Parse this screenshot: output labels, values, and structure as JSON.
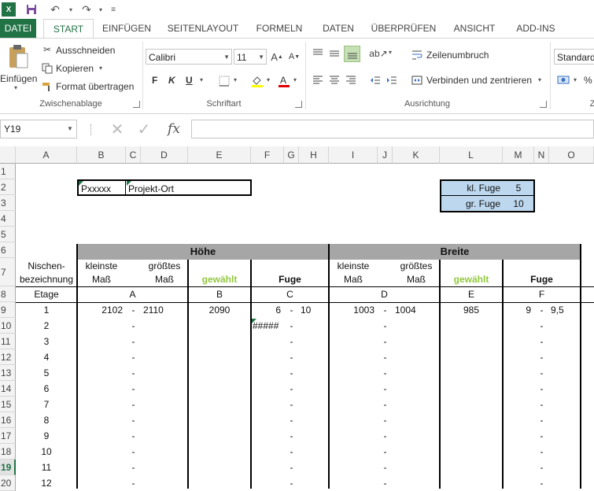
{
  "quick_access": {
    "app_icon": "excel-icon",
    "save_icon": "save-icon",
    "undo_icon": "undo-icon",
    "redo_icon": "redo-icon",
    "customize_icon": "customize-qat-icon"
  },
  "tabs": [
    {
      "label": "DATEI"
    },
    {
      "label": "START"
    },
    {
      "label": "EINFÜGEN"
    },
    {
      "label": "SEITENLAYOUT"
    },
    {
      "label": "FORMELN"
    },
    {
      "label": "DATEN"
    },
    {
      "label": "ÜBERPRÜFEN"
    },
    {
      "label": "ANSICHT"
    },
    {
      "label": "ADD-INS"
    }
  ],
  "ribbon": {
    "clipboard": {
      "paste_label": "Einfügen",
      "cut_label": "Ausschneiden",
      "copy_label": "Kopieren",
      "format_painter_label": "Format übertragen",
      "group_label": "Zwischenablage"
    },
    "font": {
      "font_name": "Calibri",
      "font_size": "11",
      "bold": "F",
      "italic": "K",
      "underline": "U",
      "group_label": "Schriftart"
    },
    "alignment": {
      "wrap_label": "Zeilenumbruch",
      "merge_label": "Verbinden und zentrieren",
      "group_label": "Ausrichtung"
    },
    "number": {
      "format": "Standard",
      "percent": "%",
      "group_label": "Z"
    }
  },
  "formula_bar": {
    "name_box": "Y19",
    "cancel_icon": "cancel-icon",
    "enter_icon": "enter-icon",
    "fx_label": "fx",
    "formula": ""
  },
  "columns": [
    "A",
    "B",
    "C",
    "D",
    "E",
    "F",
    "G",
    "H",
    "I",
    "J",
    "K",
    "L",
    "M",
    "N",
    "O"
  ],
  "rows": [
    "1",
    "2",
    "3",
    "4",
    "5",
    "6",
    "7",
    "8",
    "9",
    "10",
    "11",
    "12",
    "13",
    "14",
    "15",
    "16",
    "17",
    "18",
    "19",
    "20"
  ],
  "selected_row": "19",
  "sheet": {
    "project_nr": "Pxxxxx",
    "project_ort": "Projekt-Ort",
    "kl_fuge_label": "kl. Fuge",
    "kl_fuge_value": "5",
    "gr_fuge_label": "gr. Fuge",
    "gr_fuge_value": "10",
    "hoehe_header": "Höhe",
    "breite_header": "Breite",
    "nischen_label": "Nischen-",
    "bezeichnung_label": "bezeichnung",
    "kleinste": "kleinste",
    "groesstes": "größtes",
    "mass": "Maß",
    "gewaehlt": "gewählt",
    "fuge": "Fuge",
    "etage_label": "Etage",
    "letter_a": "A",
    "letter_b": "B",
    "letter_c": "C",
    "letter_d": "D",
    "letter_e": "E",
    "letter_f": "F",
    "etagen": [
      "1",
      "2",
      "3",
      "4",
      "5",
      "6",
      "7",
      "8",
      "9",
      "10",
      "11",
      "12"
    ],
    "dash": "-",
    "row9": {
      "h_min": "2102",
      "h_max": "2110",
      "h_sel": "2090",
      "fuge_h_min": "6",
      "fuge_h_max": "10",
      "b_min": "1003",
      "b_max": "1004",
      "b_sel": "985",
      "fuge_b_min": "9",
      "fuge_b_max": "9,5"
    },
    "row10_fuge": "#####"
  }
}
